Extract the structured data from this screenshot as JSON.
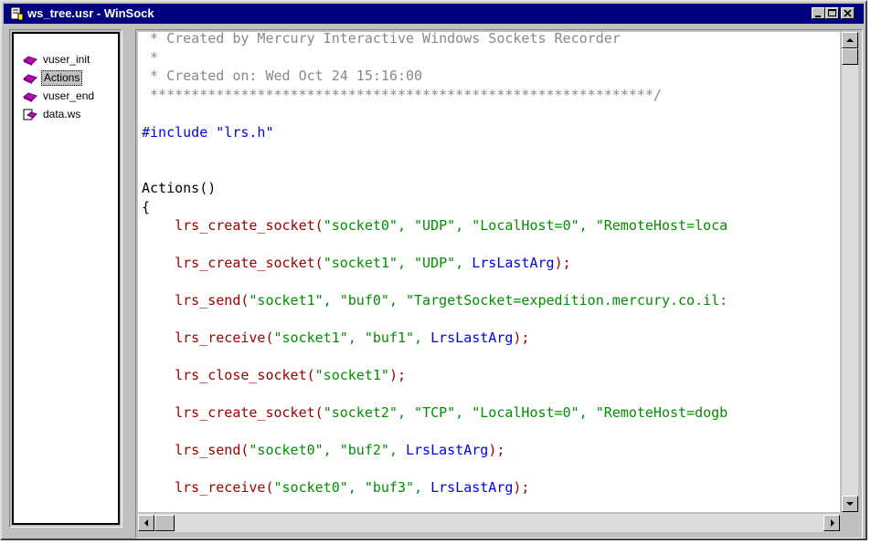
{
  "window": {
    "title": "ws_tree.usr - WinSock",
    "buttons": {
      "minimize": "minimize",
      "maximize": "maximize",
      "close": "close"
    }
  },
  "tree": {
    "items": [
      {
        "label": "vuser_init",
        "icon": "script-icon",
        "selected": false
      },
      {
        "label": "Actions",
        "icon": "script-icon",
        "selected": true
      },
      {
        "label": "vuser_end",
        "icon": "script-icon",
        "selected": false
      },
      {
        "label": "data.ws",
        "icon": "data-file-icon",
        "selected": false
      }
    ]
  },
  "code": {
    "lines": [
      [
        {
          "t": " * Created by Mercury Interactive Windows Sockets Recorder",
          "c": "comment"
        }
      ],
      [
        {
          "t": " *",
          "c": "comment"
        }
      ],
      [
        {
          "t": " * Created on: Wed Oct 24 15:16:00",
          "c": "comment"
        }
      ],
      [
        {
          "t": " *************************************************************/",
          "c": "comment"
        }
      ],
      [],
      [
        {
          "t": "#include \"lrs.h\"",
          "c": "pre"
        }
      ],
      [],
      [],
      [
        {
          "t": "Actions()",
          "c": "plain"
        }
      ],
      [
        {
          "t": "{",
          "c": "plain"
        }
      ],
      [
        {
          "t": "    ",
          "c": "plain"
        },
        {
          "t": "lrs_create_socket(",
          "c": "func"
        },
        {
          "t": "\"socket0\", \"UDP\", \"LocalHost=0\", \"RemoteHost=loca",
          "c": "str"
        }
      ],
      [],
      [
        {
          "t": "    ",
          "c": "plain"
        },
        {
          "t": "lrs_create_socket(",
          "c": "func"
        },
        {
          "t": "\"socket1\", \"UDP\", ",
          "c": "str"
        },
        {
          "t": "LrsLastArg",
          "c": "const"
        },
        {
          "t": ");",
          "c": "func"
        }
      ],
      [],
      [
        {
          "t": "    ",
          "c": "plain"
        },
        {
          "t": "lrs_send(",
          "c": "func"
        },
        {
          "t": "\"socket1\", \"buf0\", \"TargetSocket=expedition.mercury.co.il:",
          "c": "str"
        }
      ],
      [],
      [
        {
          "t": "    ",
          "c": "plain"
        },
        {
          "t": "lrs_receive(",
          "c": "func"
        },
        {
          "t": "\"socket1\", \"buf1\", ",
          "c": "str"
        },
        {
          "t": "LrsLastArg",
          "c": "const"
        },
        {
          "t": ");",
          "c": "func"
        }
      ],
      [],
      [
        {
          "t": "    ",
          "c": "plain"
        },
        {
          "t": "lrs_close_socket(",
          "c": "func"
        },
        {
          "t": "\"socket1\"",
          "c": "str"
        },
        {
          "t": ");",
          "c": "func"
        }
      ],
      [],
      [
        {
          "t": "    ",
          "c": "plain"
        },
        {
          "t": "lrs_create_socket(",
          "c": "func"
        },
        {
          "t": "\"socket2\", \"TCP\", \"LocalHost=0\", \"RemoteHost=dogb",
          "c": "str"
        }
      ],
      [],
      [
        {
          "t": "    ",
          "c": "plain"
        },
        {
          "t": "lrs_send(",
          "c": "func"
        },
        {
          "t": "\"socket0\", \"buf2\", ",
          "c": "str"
        },
        {
          "t": "LrsLastArg",
          "c": "const"
        },
        {
          "t": ");",
          "c": "func"
        }
      ],
      [],
      [
        {
          "t": "    ",
          "c": "plain"
        },
        {
          "t": "lrs_receive(",
          "c": "func"
        },
        {
          "t": "\"socket0\", \"buf3\", ",
          "c": "str"
        },
        {
          "t": "LrsLastArg",
          "c": "const"
        },
        {
          "t": ");",
          "c": "func"
        }
      ]
    ]
  },
  "colors": {
    "titlebar": "#000080",
    "comment": "#888888",
    "function": "#a00000",
    "string": "#009000",
    "constant": "#0000ff"
  }
}
